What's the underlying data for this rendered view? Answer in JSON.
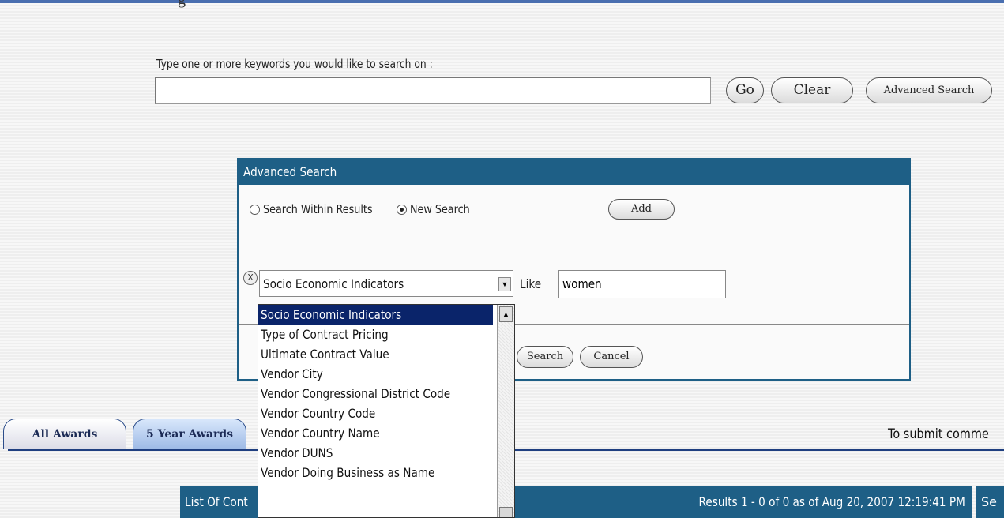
{
  "top_fragment": "g",
  "keyword_search": {
    "label": "Type one or more keywords you would like to search on :",
    "value": "",
    "go_label": "Go",
    "clear_label": "Clear",
    "advanced_label": "Advanced Search"
  },
  "advanced_search": {
    "title": "Advanced Search",
    "radio_within": "Search Within Results",
    "radio_new": "New Search",
    "add_label": "Add",
    "remove_icon": "X",
    "field_value": "Socio Economic Indicators",
    "operator": "Like",
    "value": "women",
    "search_label": "Search",
    "cancel_label": "Cancel"
  },
  "dropdown": {
    "options": [
      "Socio Economic Indicators",
      "Type of Contract Pricing",
      "Ultimate Contract Value",
      "Vendor City",
      "Vendor Congressional District Code",
      "Vendor Country Code",
      "Vendor Country Name",
      "Vendor DUNS",
      "Vendor Doing Business as Name"
    ]
  },
  "tabs": {
    "all_awards": "All Awards",
    "five_year_awards": "5 Year Awards"
  },
  "submit_text": "To submit comme",
  "list_bar": {
    "title": "List Of Cont",
    "results": "Results 1 - 0 of 0 as of Aug 20, 2007 12:19:41 PM",
    "se": "Se"
  },
  "colors": {
    "header_blue": "#1e5f86",
    "selection_blue": "#0a246a",
    "tab_rule": "#1f3f80"
  }
}
